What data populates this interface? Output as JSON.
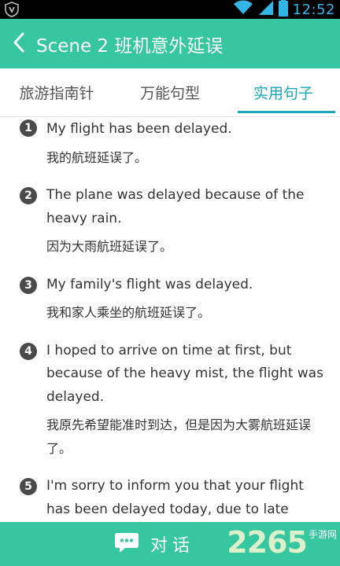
{
  "status_bar": {
    "time": "12:52",
    "icons": [
      "shield-app-icon",
      "wifi-icon",
      "signal-icon",
      "battery-icon"
    ]
  },
  "header": {
    "back_icon": "chevron-left-icon",
    "title": "Scene 2 班机意外延误"
  },
  "tabs": [
    {
      "label": "旅游指南针",
      "active": false
    },
    {
      "label": "万能句型",
      "active": false
    },
    {
      "label": "实用句子",
      "active": true
    }
  ],
  "sentences": [
    {
      "num": "1",
      "en": "My flight has been delayed.",
      "zh": "我的航班延误了。"
    },
    {
      "num": "2",
      "en": "The plane was delayed because of the heavy rain.",
      "zh": "因为大雨航班延误了。"
    },
    {
      "num": "3",
      "en": "My family's flight was delayed.",
      "zh": "我和家人乘坐的航班延误了。"
    },
    {
      "num": "4",
      "en": "I hoped to arrive on time at first, but because of the heavy mist, the flight was delayed.",
      "zh": "我原先希望能准时到达，但是因为大雾航班延误了。"
    },
    {
      "num": "5",
      "en": "I'm sorry to inform you that your flight has been delayed today, due to late",
      "zh": ""
    }
  ],
  "bottom_bar": {
    "icon": "chat-bubble-icon",
    "label": "对话",
    "watermark_number": "2265",
    "watermark_sub": "手游网"
  },
  "colors": {
    "accent": "#36c6a0",
    "tab_active": "#1aa6b7",
    "status_time": "#33b5e5"
  }
}
